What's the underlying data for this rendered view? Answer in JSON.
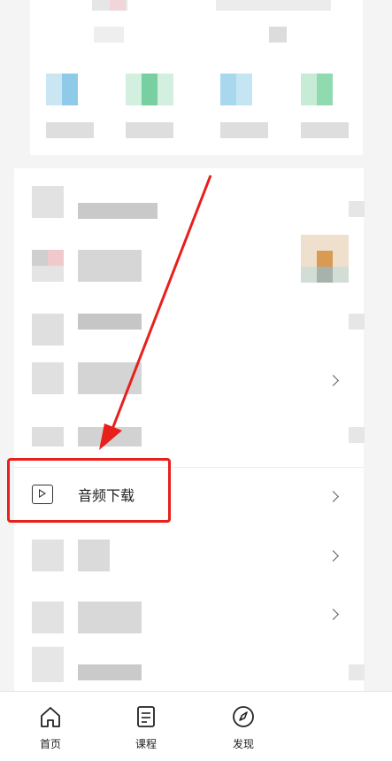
{
  "highlighted_item": {
    "label": "音频下载",
    "icon": "play-square-icon"
  },
  "tabbar": {
    "tabs": [
      {
        "label": "首页",
        "icon": "home-icon"
      },
      {
        "label": "课程",
        "icon": "course-list-icon"
      },
      {
        "label": "发现",
        "icon": "discover-compass-icon"
      }
    ]
  },
  "colors": {
    "annotation_red": "#e8201c",
    "blue_tile": "#9fd0ea",
    "green_tile": "#7fd3a3",
    "orange_tile": "#d99b52"
  }
}
